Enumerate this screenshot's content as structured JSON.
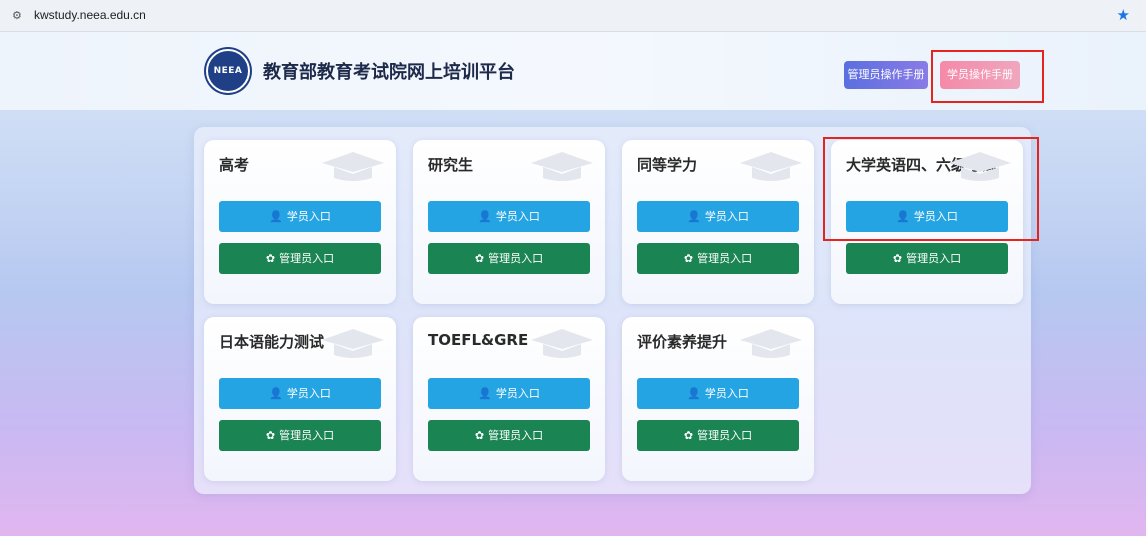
{
  "browser": {
    "url": "kwstudy.neea.edu.cn",
    "tune_icon": "tune-icon",
    "star_icon": "bookmark-star-icon"
  },
  "header": {
    "logo_text": "NEEA",
    "title": "教育部教育考试院网上培训平台",
    "admin_manual": "管理员操作手册",
    "student_manual": "学员操作手册"
  },
  "cards": [
    {
      "title": "高考",
      "student": "学员入口",
      "admin": "管理员入口"
    },
    {
      "title": "研究生",
      "student": "学员入口",
      "admin": "管理员入口"
    },
    {
      "title": "同等学力",
      "student": "学员入口",
      "admin": "管理员入口"
    },
    {
      "title": "大学英语四、六级考试",
      "student": "学员入口",
      "admin": "管理员入口"
    },
    {
      "title": "日本语能力测试",
      "student": "学员入口",
      "admin": "管理员入口"
    },
    {
      "title": "TOEFL&GRE",
      "student": "学员入口",
      "admin": "管理员入口"
    },
    {
      "title": "评价素养提升",
      "student": "学员入口",
      "admin": "管理员入口"
    }
  ],
  "icons": {
    "student": "user-icon",
    "admin": "gear-icon",
    "card": "graduation-cap-icon"
  },
  "colors": {
    "student_btn": "#25a4e4",
    "admin_btn": "#1a8452",
    "highlight": "#e5231f"
  }
}
